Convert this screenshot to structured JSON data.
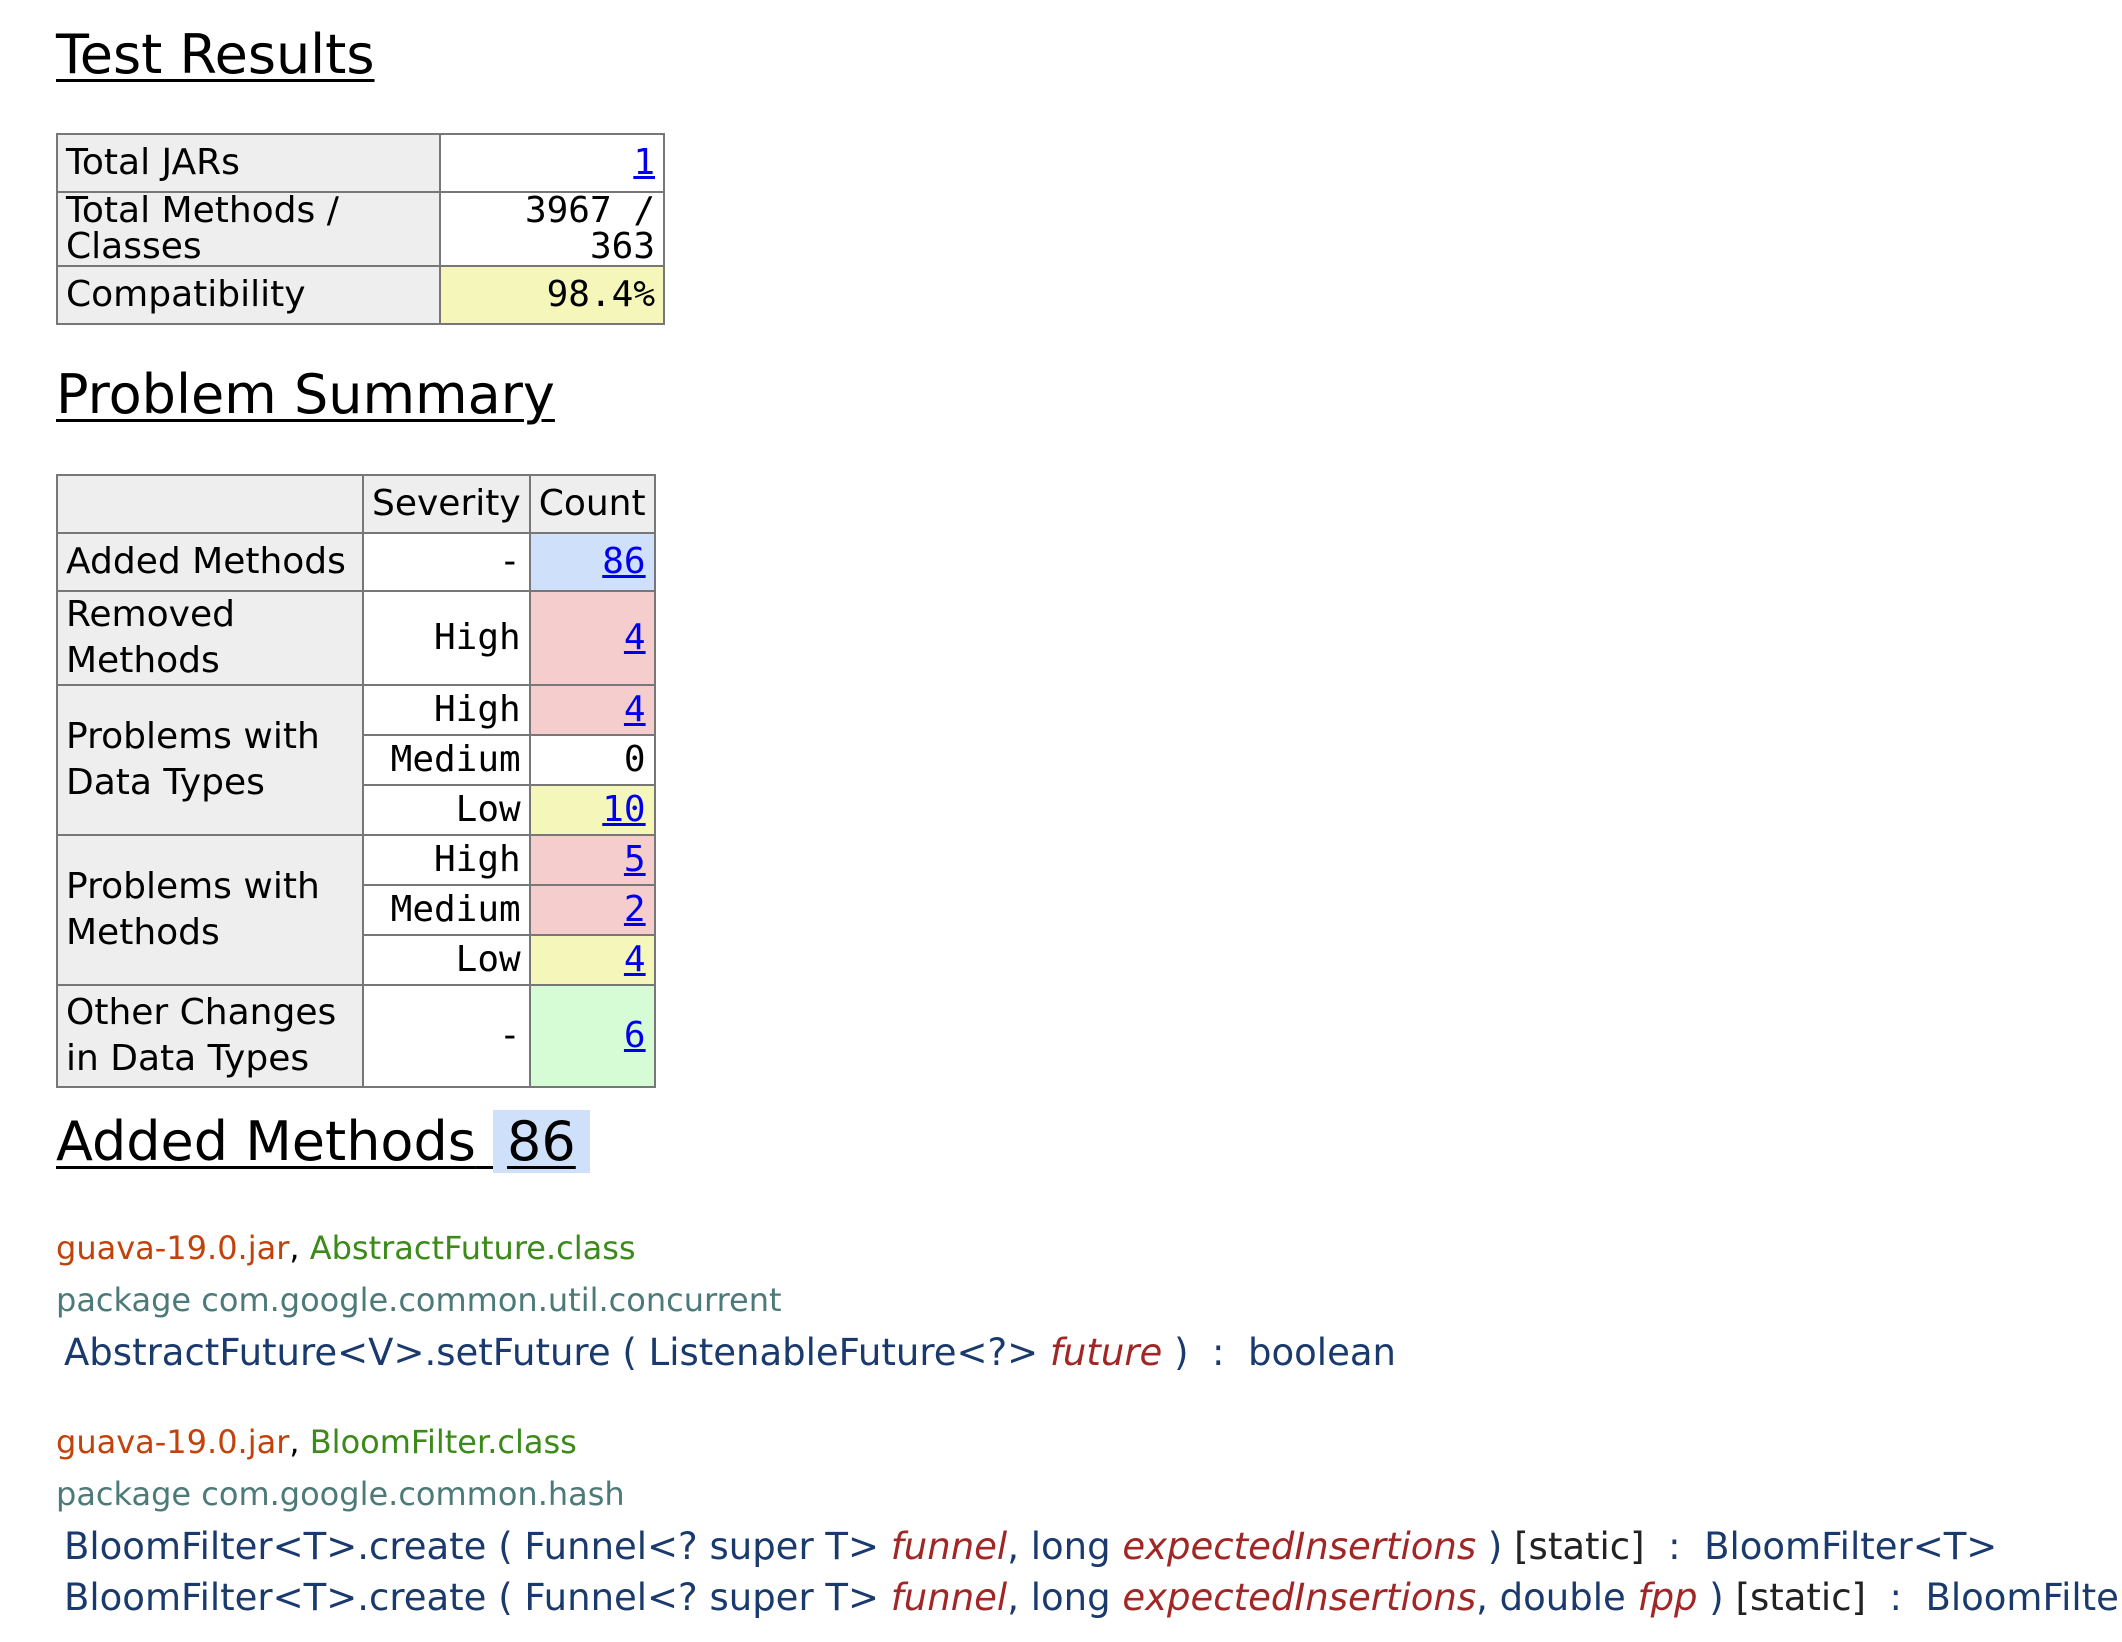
{
  "test_results": {
    "title": "Test Results",
    "rows": [
      {
        "label": "Total JARs",
        "value": "1"
      },
      {
        "label": "Total Methods / Classes",
        "value": "3967 / 363"
      },
      {
        "label": "Compatibility",
        "value": "98.4%"
      }
    ]
  },
  "problem_summary": {
    "title": "Problem Summary",
    "headers": {
      "severity": "Severity",
      "count": "Count"
    },
    "added_methods": {
      "label": "Added Methods",
      "severity": "-",
      "count": "86"
    },
    "removed_methods": {
      "label": "Removed Methods",
      "severity": "High",
      "count": "4"
    },
    "data_types": {
      "label_line1": "Problems with",
      "label_line2": "Data Types",
      "rows": [
        {
          "severity": "High",
          "count": "4"
        },
        {
          "severity": "Medium",
          "count": "0"
        },
        {
          "severity": "Low",
          "count": "10"
        }
      ]
    },
    "methods": {
      "label_line1": "Problems with",
      "label_line2": "Methods",
      "rows": [
        {
          "severity": "High",
          "count": "5"
        },
        {
          "severity": "Medium",
          "count": "2"
        },
        {
          "severity": "Low",
          "count": "4"
        }
      ]
    },
    "other_changes": {
      "label_line1": "Other Changes",
      "label_line2": "in Data Types",
      "severity": "-",
      "count": "6"
    },
    "colors": {
      "added": "#cfe0fb",
      "high": "#f5cdcd",
      "low": "#f5f6ba",
      "other": "#d6fcd6"
    }
  },
  "added_methods": {
    "title": "Added Methods",
    "count": "86",
    "entries": [
      {
        "jar": "guava-19.0.jar",
        "sep": ",",
        "class": "AbstractFuture.class",
        "package": "package com.google.common.util.concurrent",
        "signatures": [
          {
            "name": "AbstractFuture<V>.setFuture",
            "open": " ( ",
            "p1_type": "ListenableFuture<?> ",
            "p1_name": "future",
            "p2_sep": "",
            "p2_type": "",
            "p2_name": "",
            "p3_sep": "",
            "p3_type": "",
            "p3_name": "",
            "close": " ) ",
            "attr": "",
            "ret": " :  boolean"
          }
        ]
      },
      {
        "jar": "guava-19.0.jar",
        "sep": ",",
        "class": "BloomFilter.class",
        "package": "package com.google.common.hash",
        "signatures": [
          {
            "name": "BloomFilter<T>.create",
            "open": " ( ",
            "p1_type": "Funnel<? super T> ",
            "p1_name": "funnel",
            "p2_sep": ", ",
            "p2_type": "long ",
            "p2_name": "expectedInsertions",
            "p3_sep": "",
            "p3_type": "",
            "p3_name": "",
            "close": " ) ",
            "attr": "[static]",
            "ret": "  :  BloomFilter<T>"
          },
          {
            "name": "BloomFilter<T>.create",
            "open": " ( ",
            "p1_type": "Funnel<? super T> ",
            "p1_name": "funnel",
            "p2_sep": ", ",
            "p2_type": "long ",
            "p2_name": "expectedInsertions",
            "p3_sep": ", ",
            "p3_type": "double ",
            "p3_name": "fpp",
            "close": " ) ",
            "attr": "[static]",
            "ret": "  :  BloomFilter<T>"
          }
        ]
      }
    ]
  }
}
